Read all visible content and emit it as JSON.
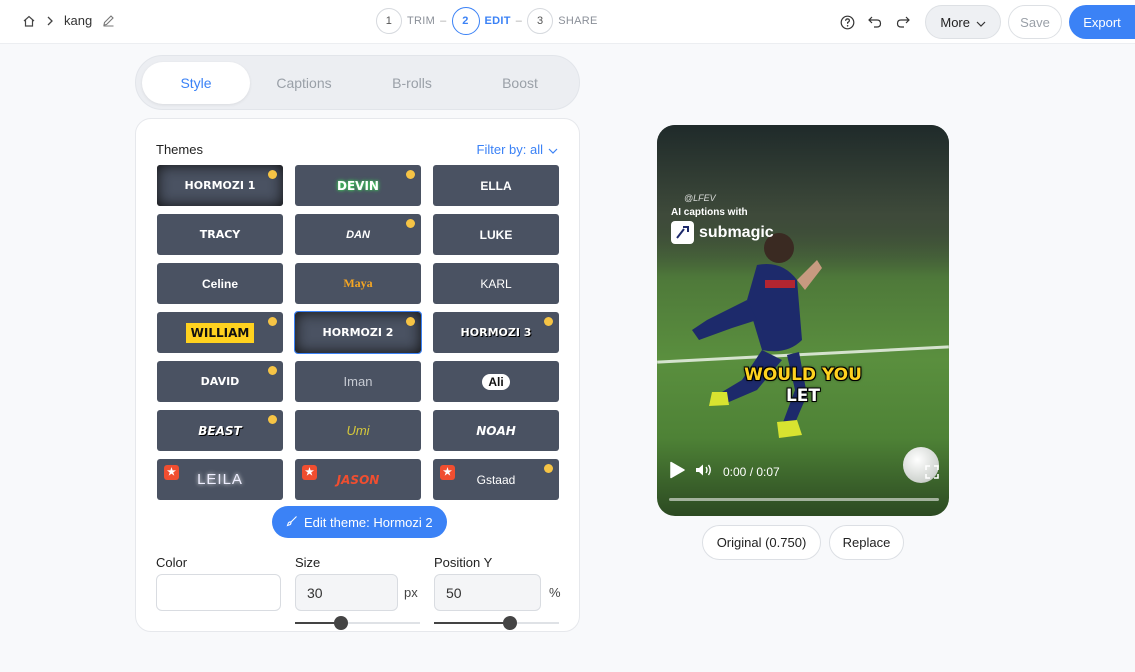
{
  "breadcrumb": {
    "project": "kang"
  },
  "steps": [
    {
      "num": "1",
      "label": "TRIM"
    },
    {
      "num": "2",
      "label": "EDIT"
    },
    {
      "num": "3",
      "label": "SHARE"
    }
  ],
  "toolbar": {
    "more_label": "More",
    "save_label": "Save",
    "export_label": "Export"
  },
  "tabs": [
    "Style",
    "Captions",
    "B-rolls",
    "Boost"
  ],
  "themes": {
    "title": "Themes",
    "filter_label": "Filter by: all",
    "tiles": [
      "HORMOZI 1",
      "DEVIN",
      "ELLA",
      "TRACY",
      "DAN",
      "LUKE",
      "Celine",
      "Maya",
      "KARL",
      "WILLIAM",
      "HORMOZI 2",
      "HORMOZI 3",
      "DAVID",
      "Iman",
      "Ali",
      "BEAST",
      "Umi",
      "NOAH",
      "LEILA",
      "JASON",
      "Gstaad"
    ]
  },
  "edit_theme_label": "Edit theme: Hormozi 2",
  "fields": {
    "color_label": "Color",
    "size_label": "Size",
    "size_value": "30",
    "size_unit": "px",
    "position_label": "Position Y",
    "position_value": "50",
    "position_unit": "%",
    "size_slider_fraction": 0.37,
    "position_slider_fraction": 0.61
  },
  "video": {
    "watermark_handle": "@LFEV",
    "watermark_line": "AI captions with",
    "watermark_brand": "submagic",
    "caption_line1": "WOULD YOU",
    "caption_line2": "LET",
    "time": "0:00 / 0:07"
  },
  "buttons": {
    "original": "Original (0.750)",
    "replace": "Replace"
  },
  "colors": {
    "accent": "#3b82f6",
    "tile_bg": "#4a5262",
    "caption_yellow": "#ffd21f"
  }
}
